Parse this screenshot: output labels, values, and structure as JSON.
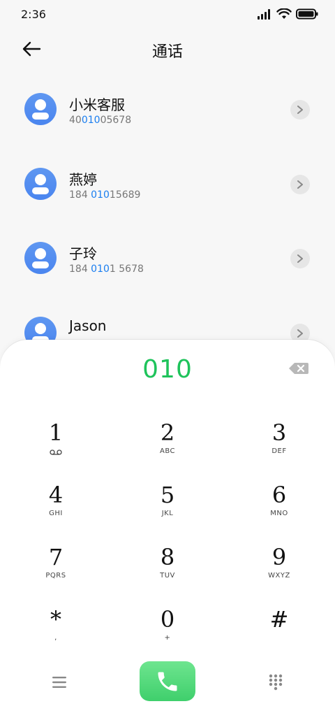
{
  "status_bar": {
    "time": "2:36"
  },
  "header": {
    "title": "通话"
  },
  "contacts": [
    {
      "name": "小米客服",
      "number_parts": [
        "40",
        "010",
        "05678"
      ]
    },
    {
      "name": "燕婷",
      "number_parts": [
        "184 ",
        "010",
        "15689"
      ]
    },
    {
      "name": "子玲",
      "number_parts": [
        "184 ",
        "010",
        "1 5678"
      ]
    },
    {
      "name": "Jason",
      "number_parts": [
        "",
        "",
        ""
      ]
    }
  ],
  "dialer": {
    "input_value": "010",
    "keys": [
      {
        "digit": "1",
        "letters": ""
      },
      {
        "digit": "2",
        "letters": "ABC"
      },
      {
        "digit": "3",
        "letters": "DEF"
      },
      {
        "digit": "4",
        "letters": "GHI"
      },
      {
        "digit": "5",
        "letters": "JKL"
      },
      {
        "digit": "6",
        "letters": "MNO"
      },
      {
        "digit": "7",
        "letters": "PQRS"
      },
      {
        "digit": "8",
        "letters": "TUV"
      },
      {
        "digit": "9",
        "letters": "WXYZ"
      },
      {
        "digit": "*",
        "letters": ","
      },
      {
        "digit": "0",
        "letters": "+"
      },
      {
        "digit": "#",
        "letters": ""
      }
    ]
  },
  "colors": {
    "accent_green": "#1ec35b",
    "highlight_blue": "#1a7ef0",
    "avatar_blue": "#5a92f0",
    "call_button_green": "#4fd87a"
  },
  "icons": {
    "back": "arrow-left-icon",
    "detail": "chevron-right-icon",
    "backspace": "backspace-icon",
    "voicemail": "voicemail-icon",
    "menu": "menu-icon",
    "call": "phone-icon",
    "keypad": "keypad-icon"
  }
}
